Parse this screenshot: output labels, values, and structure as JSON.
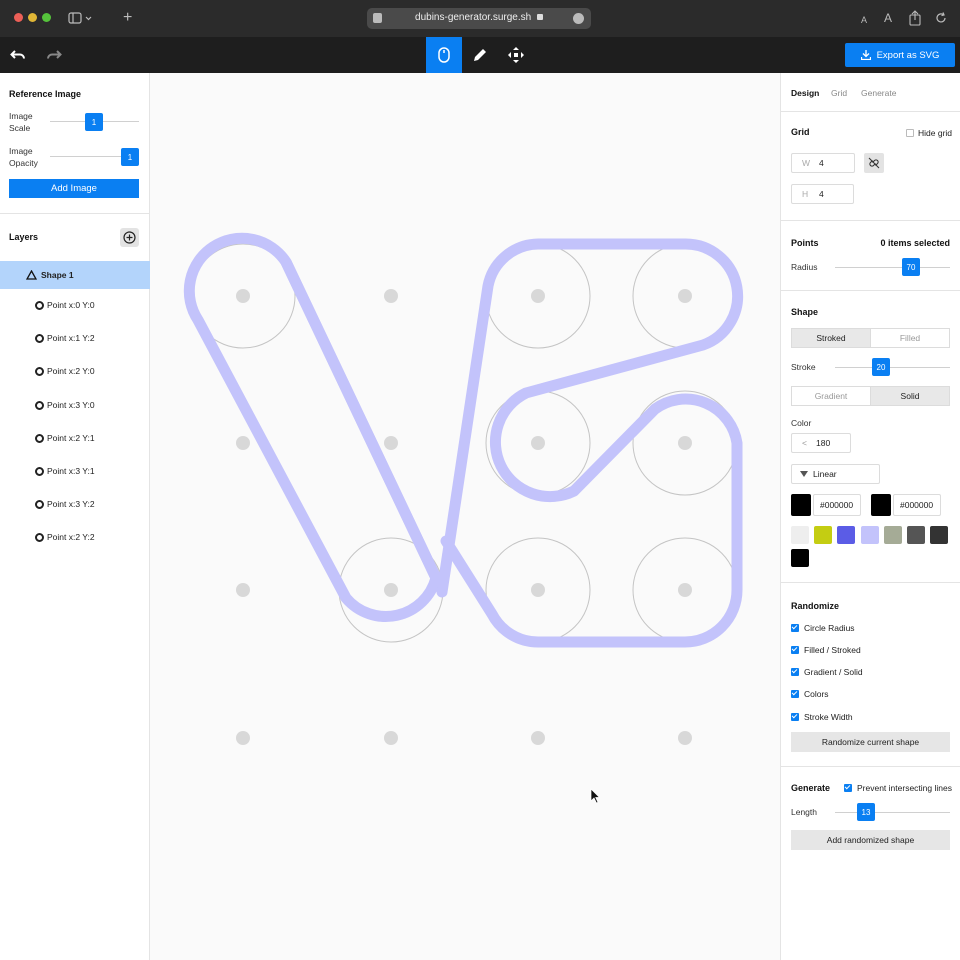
{
  "browser": {
    "url": "dubins-generator.surge.sh",
    "font_small": "A",
    "font_large": "A"
  },
  "toolbar": {
    "export_label": "Export as SVG",
    "modes": [
      "select-mode",
      "pen-mode",
      "move-mode"
    ],
    "active_mode": "select-mode",
    "accent": "#0a7ff2"
  },
  "reference": {
    "title": "Reference Image",
    "scale_label": "Image Scale",
    "scale_value": "1",
    "opacity_label": "Image Opacity",
    "opacity_value": "1",
    "add_label": "Add Image"
  },
  "layers": {
    "title": "Layers",
    "shape_label": "Shape 1",
    "points": [
      "Point x:0 Y:0",
      "Point x:1 Y:2",
      "Point x:2 Y:0",
      "Point x:3 Y:0",
      "Point x:2 Y:1",
      "Point x:3 Y:1",
      "Point x:3 Y:2",
      "Point x:2 Y:2"
    ]
  },
  "tabs": {
    "design": "Design",
    "grid": "Grid",
    "generate": "Generate",
    "active": "design"
  },
  "grid": {
    "title": "Grid",
    "hide_label": "Hide grid",
    "hide_checked": false,
    "w_label": "W",
    "w_value": "4",
    "h_label": "H",
    "h_value": "4"
  },
  "points": {
    "title": "Points",
    "selected": "0 items selected",
    "radius_label": "Radius",
    "radius_value": "70"
  },
  "shape": {
    "title": "Shape",
    "stroked": "Stroked",
    "filled": "Filled",
    "fill_mode": "stroked",
    "stroke_label": "Stroke",
    "stroke_value": "20",
    "gradient": "Gradient",
    "solid": "Solid",
    "color_mode": "solid",
    "color_label": "Color",
    "angle_prefix": "<",
    "angle_value": "180",
    "gradient_type": "Linear",
    "color1": "#000000",
    "color2": "#000000",
    "stroke_color": "#c3c3fb",
    "palette": [
      "#eeeeee",
      "#c4cd12",
      "#5b5ce6",
      "#c3c3fb",
      "#a5ab96",
      "#555555",
      "#333333",
      "#000000"
    ]
  },
  "randomize": {
    "title": "Randomize",
    "options": [
      {
        "label": "Circle Radius",
        "checked": true
      },
      {
        "label": "Filled / Stroked",
        "checked": true
      },
      {
        "label": "Gradient / Solid",
        "checked": true
      },
      {
        "label": "Colors",
        "checked": true
      },
      {
        "label": "Stroke Width",
        "checked": true
      }
    ],
    "button": "Randomize current shape"
  },
  "generate": {
    "title": "Generate",
    "prevent_label": "Prevent intersecting lines",
    "prevent_checked": true,
    "length_label": "Length",
    "length_value": "13",
    "button": "Add randomized shape"
  }
}
